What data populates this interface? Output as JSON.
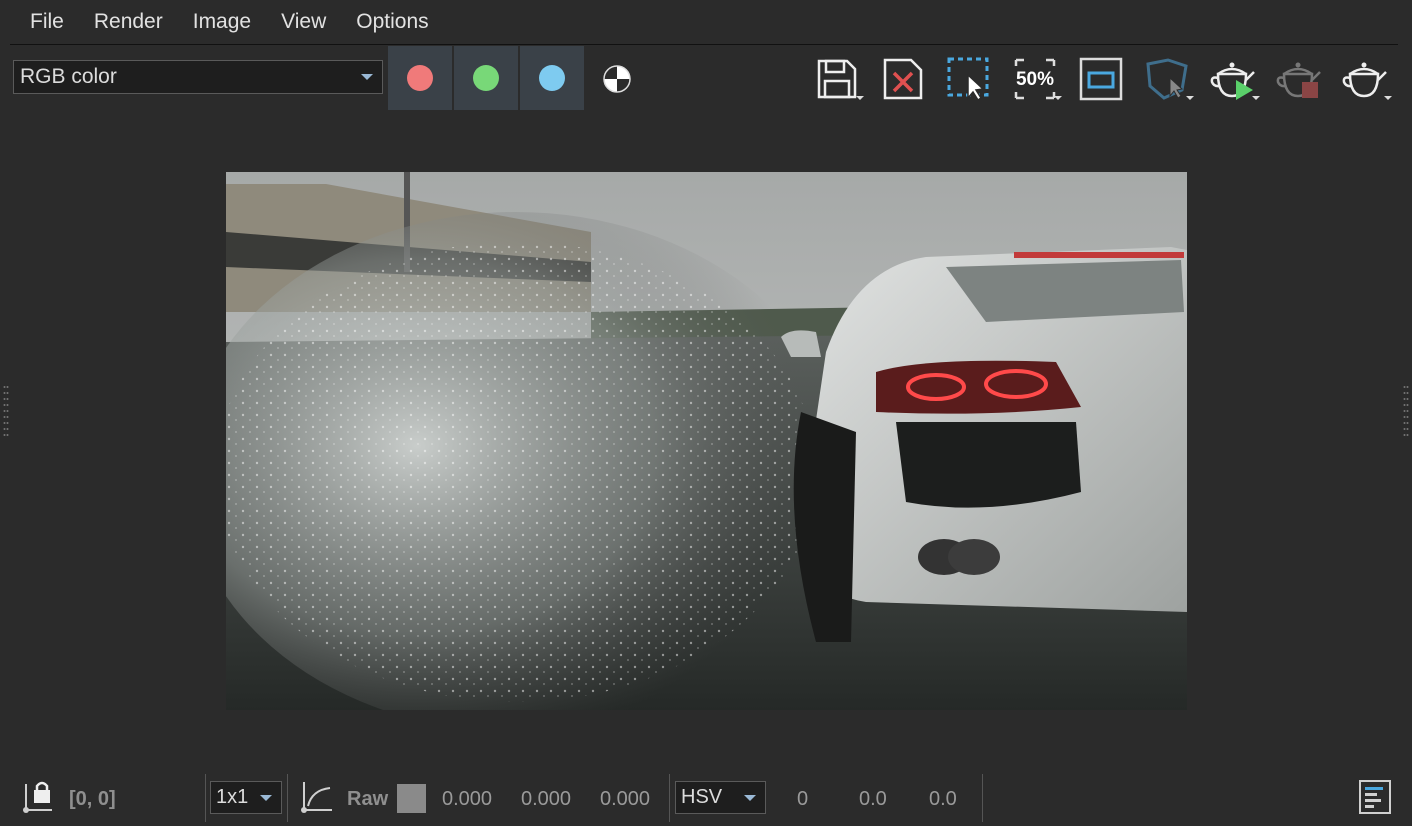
{
  "menu": [
    "File",
    "Render",
    "Image",
    "View",
    "Options"
  ],
  "toolbar": {
    "channel_mode": "RGB color",
    "channels": [
      {
        "name": "red-channel",
        "color": "#f07a7a"
      },
      {
        "name": "green-channel",
        "color": "#78d878"
      },
      {
        "name": "blue-channel",
        "color": "#7ecbf0"
      }
    ],
    "zoom_label": "50%",
    "icons": [
      "save-icon",
      "clear-icon",
      "region-select-icon",
      "zoom-icon",
      "frame-icon",
      "track-mouse-icon",
      "render-play-icon",
      "render-stop-icon",
      "render-setup-icon"
    ]
  },
  "status": {
    "coords": "[0, 0]",
    "sample_size": "1x1",
    "mode": "Raw",
    "swatch_color": "#8a8a8a",
    "rgb": [
      "0.000",
      "0.000",
      "0.000"
    ],
    "color_space": "HSV",
    "hsv": [
      "0",
      "0.0",
      "0.0"
    ]
  },
  "accent_color": "#4aa8e0"
}
